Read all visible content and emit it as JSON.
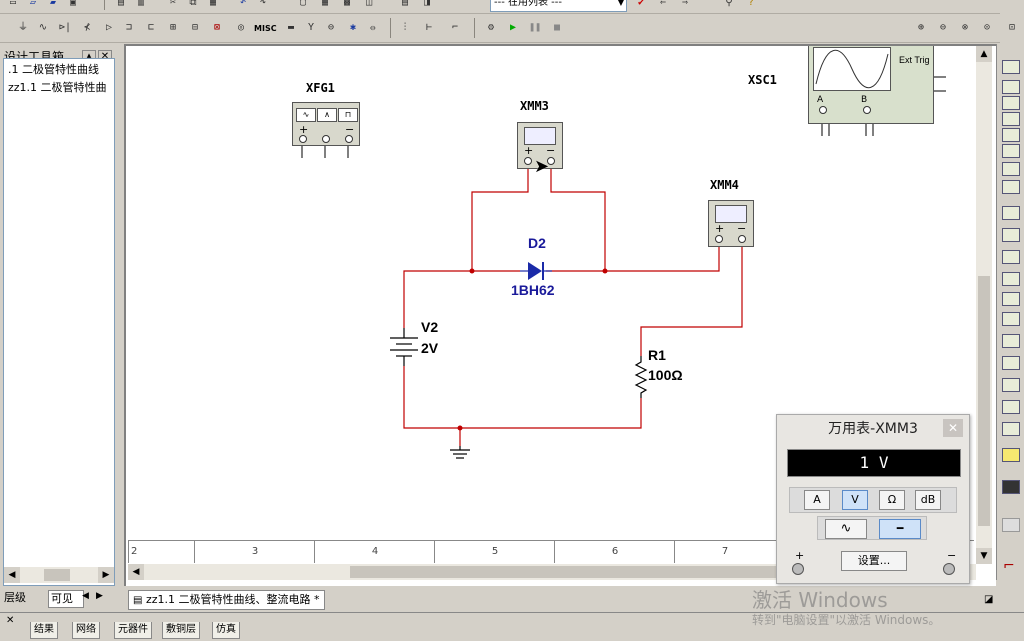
{
  "toolbar_top": {
    "component_dropdown": "--- 在用列表 ---"
  },
  "toolbar_second": {
    "misc_label": "MISC"
  },
  "design_toolbox": {
    "title": "设计工具箱",
    "tree_items": [
      ".1 二极管特性曲线",
      "zz1.1 二极管特性曲"
    ],
    "tabs": [
      "层级",
      "可见"
    ]
  },
  "schematic": {
    "instruments": {
      "xfg1": "XFG1",
      "xmm3": "XMM3",
      "xmm4": "XMM4",
      "xsc1": "XSC1",
      "xsc1_trig": "Ext Trig",
      "xsc1_a": "A",
      "xsc1_b": "B",
      "plus": "+",
      "minus": "−"
    },
    "parts": {
      "diode_ref": "D2",
      "diode_value": "1BH62",
      "battery_ref": "V2",
      "battery_value": "2V",
      "resistor_ref": "R1",
      "resistor_value": "100Ω"
    }
  },
  "ruler": {
    "labels": [
      "2",
      "3",
      "4",
      "5",
      "6",
      "7"
    ]
  },
  "document_tab": "zz1.1 二极管特性曲线、整流电路 *",
  "bottom_tabs": [
    "结果",
    "网络",
    "元器件",
    "敷铜层",
    "仿真"
  ],
  "multimeter": {
    "title": "万用表-XMM3",
    "display": "1 V",
    "modes": [
      "A",
      "V",
      "Ω",
      "dB"
    ],
    "active_mode": "V",
    "settings_button": "设置...",
    "plus": "+",
    "minus": "−"
  },
  "watermark": {
    "line1": "激活 Windows",
    "line2": "转到\"电脑设置\"以激活 Windows。"
  },
  "colors": {
    "wire": "#c00000",
    "part_label": "#1a1a9a",
    "diode": "#1a2aa8"
  }
}
